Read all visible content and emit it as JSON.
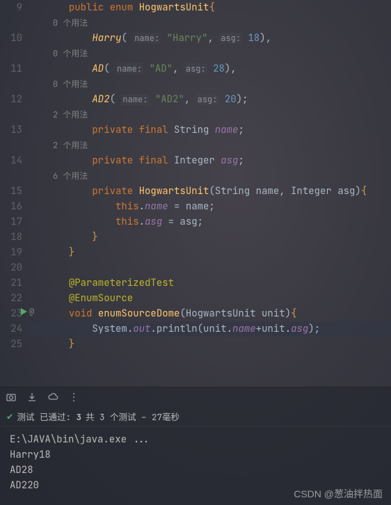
{
  "gutter": [
    "9",
    "",
    "10",
    "",
    "11",
    "",
    "12",
    "",
    "13",
    "",
    "14",
    "",
    "15",
    "16",
    "17",
    "18",
    "19",
    "20",
    "21",
    "22",
    "23",
    "24",
    "25"
  ],
  "lines": {
    "l9": {
      "kw1": "public",
      "kw2": "enum",
      "cls": "HogwartsUnit",
      "brace": "{"
    },
    "h9": "0 个用法",
    "l10": {
      "id": "Harry",
      "p1": "name:",
      "s1": "\"Harry\"",
      "p2": "asg:",
      "n1": "18"
    },
    "h10": "0 个用法",
    "l11": {
      "id": "AD",
      "p1": "name:",
      "s1": "\"AD\"",
      "p2": "asg:",
      "n1": "28"
    },
    "h11": "0 个用法",
    "l12": {
      "id": "AD2",
      "p1": "name:",
      "s1": "\"AD2\"",
      "p2": "asg:",
      "n1": "20"
    },
    "h12": "2 个用法",
    "l13": {
      "kw1": "private",
      "kw2": "final",
      "t": "String",
      "id": "name"
    },
    "h13": "2 个用法",
    "l14": {
      "kw1": "private",
      "kw2": "final",
      "t": "Integer",
      "id": "asg"
    },
    "h14": "6 个用法",
    "l15": {
      "kw1": "private",
      "ctor": "HogwartsUnit",
      "sig": "(String name, Integer asg)",
      "brace": "{"
    },
    "l16": {
      "kw": "this",
      "field": "name",
      "eq": " = name;"
    },
    "l17": {
      "kw": "this",
      "field": "asg",
      "eq": " = asg;"
    },
    "l18": "}",
    "l19": "}",
    "l21": "@ParameterizedTest",
    "l22": "@EnumSource",
    "l23": {
      "kw": "void",
      "m": "enumSourceDome",
      "sig": "(HogwartsUnit unit)",
      "brace": "{"
    },
    "l24": {
      "sys": "System",
      "out": "out",
      "m": "println",
      "u": "unit",
      "f1": "name",
      "f2": "asg"
    },
    "l25": "}"
  },
  "testStatus": {
    "label": "测试 已通过:",
    "passed": "3",
    "rest": "共 3 个测试 – 27毫秒"
  },
  "console": {
    "cmd": "E:\\JAVA\\bin\\java.exe ...",
    "out": [
      "Harry18",
      "AD28",
      "AD220"
    ]
  },
  "watermark": "CSDN @葱油拌热面"
}
